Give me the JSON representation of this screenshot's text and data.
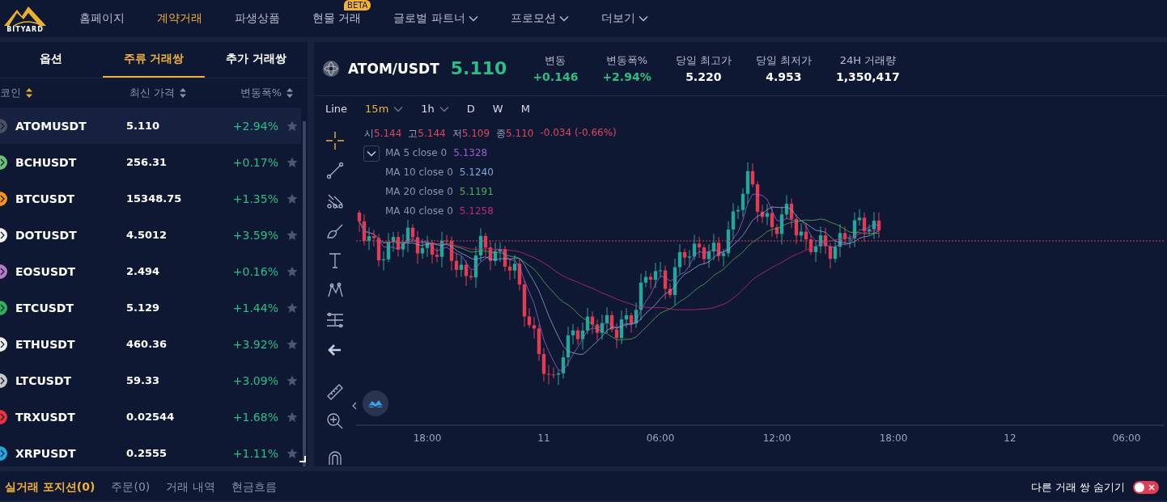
{
  "nav": {
    "logo": "BITYARD",
    "items": [
      {
        "label": "홈페이지",
        "selected": false,
        "dropdown": false
      },
      {
        "label": "계약거래",
        "selected": true,
        "dropdown": false
      },
      {
        "label": "파생상품",
        "selected": false,
        "dropdown": false
      },
      {
        "label": "현물 거래",
        "selected": false,
        "dropdown": false,
        "badge": "BETA"
      },
      {
        "label": "글로벌 파트너",
        "selected": false,
        "dropdown": true
      },
      {
        "label": "프로모션",
        "selected": false,
        "dropdown": true
      },
      {
        "label": "더보기",
        "selected": false,
        "dropdown": true
      }
    ]
  },
  "pair_list": {
    "tabs": [
      {
        "label": "옵션",
        "selected": false
      },
      {
        "label": "주류 거래쌍",
        "selected": true
      },
      {
        "label": "추가 거래쌍",
        "selected": false
      }
    ],
    "columns": [
      "코인",
      "최신 가격",
      "변동폭%"
    ],
    "rows": [
      {
        "coin": "ATOMUSDT",
        "price": "5.110",
        "change": "+2.94%",
        "color": "#4a4e63",
        "selected": true,
        "favorite": false
      },
      {
        "coin": "BCHUSDT",
        "price": "256.31",
        "change": "+0.17%",
        "color": "#6cbf73",
        "selected": false,
        "favorite": false
      },
      {
        "coin": "BTCUSDT",
        "price": "15348.75",
        "change": "+1.35%",
        "color": "#f7931a",
        "selected": false,
        "favorite": false
      },
      {
        "coin": "DOTUSDT",
        "price": "4.5012",
        "change": "+3.59%",
        "color": "#f4f4f4",
        "selected": false,
        "favorite": false
      },
      {
        "coin": "EOSUSDT",
        "price": "2.494",
        "change": "+0.16%",
        "color": "#b57cc4",
        "selected": false,
        "favorite": false
      },
      {
        "coin": "ETCUSDT",
        "price": "5.129",
        "change": "+1.44%",
        "color": "#2fb25b",
        "selected": false,
        "favorite": false
      },
      {
        "coin": "ETHUSDT",
        "price": "460.36",
        "change": "+3.92%",
        "color": "#f0f0f0",
        "selected": false,
        "favorite": false
      },
      {
        "coin": "LTCUSDT",
        "price": "59.33",
        "change": "+3.09%",
        "color": "#c8c8c8",
        "selected": false,
        "favorite": false
      },
      {
        "coin": "TRXUSDT",
        "price": "0.02544",
        "change": "+1.68%",
        "color": "#e8343f",
        "selected": false,
        "favorite": false
      },
      {
        "coin": "XRPUSDT",
        "price": "0.2555",
        "change": "+1.11%",
        "color": "#24a6e0",
        "selected": false,
        "favorite": false
      }
    ]
  },
  "market": {
    "pair": "ATOM/USDT",
    "price": "5.110",
    "stats": [
      {
        "label": "변동",
        "value": "+0.146",
        "kind": "change"
      },
      {
        "label": "변동폭%",
        "value": "+2.94%",
        "kind": "change"
      },
      {
        "label": "당일 최고가",
        "value": "5.220",
        "kind": "plain"
      },
      {
        "label": "당일 최저가",
        "value": "4.953",
        "kind": "plain"
      },
      {
        "label": "24H 거래량",
        "value": "1,350,417",
        "kind": "plain"
      }
    ]
  },
  "chart": {
    "intervals": [
      {
        "label": "Line",
        "selected": false,
        "dropdown": false
      },
      {
        "label": "15m",
        "selected": true,
        "dropdown": true
      },
      {
        "label": "1h",
        "selected": false,
        "dropdown": true
      },
      {
        "label": "D",
        "selected": false,
        "dropdown": false
      },
      {
        "label": "W",
        "selected": false,
        "dropdown": false
      },
      {
        "label": "M",
        "selected": false,
        "dropdown": false
      }
    ],
    "ohlc": [
      {
        "label": "시",
        "value": "5.144"
      },
      {
        "label": "고",
        "value": "5.144"
      },
      {
        "label": "저",
        "value": "5.109"
      },
      {
        "label": "종",
        "value": "5.110"
      }
    ],
    "change": "-0.034 (-0.66%)",
    "indicators": [
      {
        "label": "MA 5 close 0",
        "value": "5.1328",
        "color": "#9c5fc9"
      },
      {
        "label": "MA 10 close 0",
        "value": "5.1240",
        "color": "#7fa7dc"
      },
      {
        "label": "MA 20 close 0",
        "value": "5.1191",
        "color": "#4caf50"
      },
      {
        "label": "MA 40 close 0",
        "value": "5.1258",
        "color": "#c2257e"
      }
    ],
    "time_labels": [
      "18:00",
      "11",
      "06:00",
      "12:00",
      "18:00",
      "12",
      "06:00"
    ]
  },
  "bottom": {
    "tabs": [
      {
        "label": "실거래 포지션(0)",
        "selected": true
      },
      {
        "label": "주문(0)",
        "selected": false
      },
      {
        "label": "거래 내역",
        "selected": false
      },
      {
        "label": "현금흐름",
        "selected": false
      }
    ],
    "toggle": {
      "label": "다른 거래 쌍 숨기기",
      "on": false
    }
  }
}
